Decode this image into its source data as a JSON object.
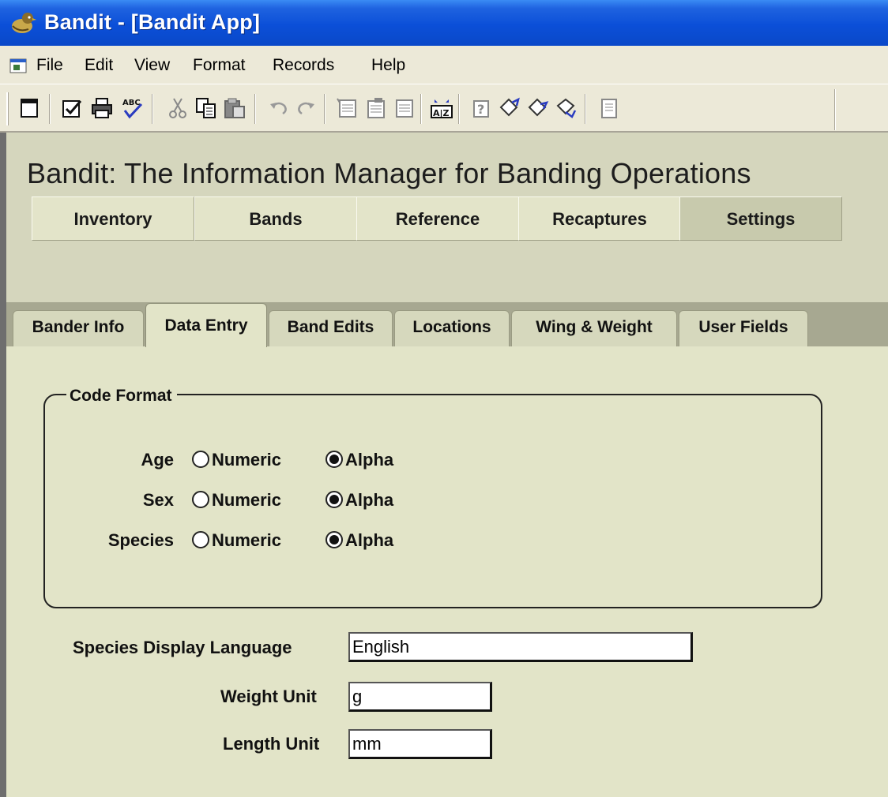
{
  "window": {
    "title": "Bandit - [Bandit App]"
  },
  "menu": [
    "File",
    "Edit",
    "View",
    "Format",
    "Records",
    "Help"
  ],
  "toolbar": {
    "buttons": [
      "form-view",
      "check",
      "print",
      "spelling",
      "cut",
      "copy",
      "paste",
      "undo",
      "redo",
      "new-record",
      "delete-record",
      "record",
      "sort",
      "help",
      "records-a",
      "records-b",
      "records-c",
      "filter"
    ]
  },
  "header": {
    "heading": "Bandit: The Information Manager for Banding Operations",
    "nav": [
      "Inventory",
      "Bands",
      "Reference",
      "Recaptures",
      "Settings"
    ],
    "active_nav": "Settings"
  },
  "tabs": [
    "Bander Info",
    "Data Entry",
    "Band Edits",
    "Locations",
    "Wing & Weight",
    "User Fields"
  ],
  "active_tab": "Data Entry",
  "code_format": {
    "legend": "Code Format",
    "option_numeric": "Numeric",
    "option_alpha": "Alpha",
    "rows": [
      {
        "label": "Age",
        "selected": "Alpha"
      },
      {
        "label": "Sex",
        "selected": "Alpha"
      },
      {
        "label": "Species",
        "selected": "Alpha"
      }
    ]
  },
  "fields": {
    "species_language": {
      "label": "Species Display Language",
      "value": "English"
    },
    "weight_unit": {
      "label": "Weight Unit",
      "value": "g"
    },
    "length_unit": {
      "label": "Length Unit",
      "value": "mm"
    }
  }
}
